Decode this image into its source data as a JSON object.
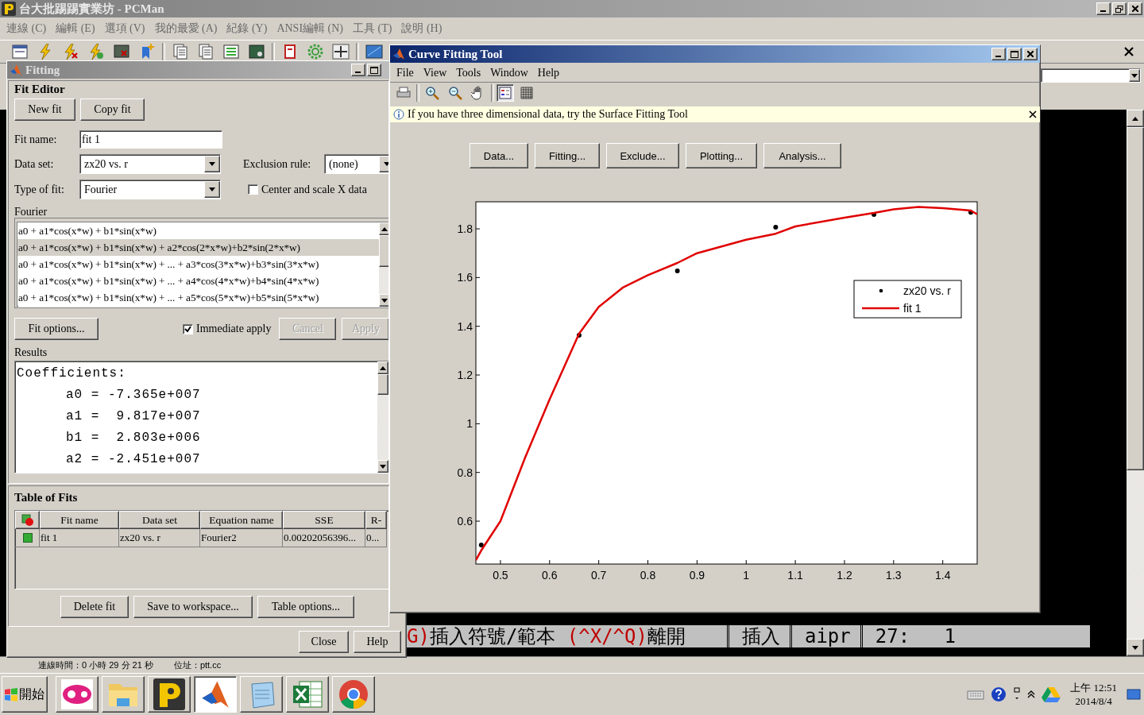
{
  "pcman": {
    "title": "台大批踢踢實業坊 - PCMan",
    "menu": [
      "連線 (C)",
      "編輯 (E)",
      "選項 (V)",
      "我的最愛 (A)",
      "紀錄 (Y)",
      "ANSI編輯 (N)",
      "工具 (T)",
      "說明 (H)"
    ],
    "terminal_status": [
      {
        "text": "G)",
        "color": "#c00000"
      },
      {
        "text": "插入符號/範本 ",
        "color": "#000000"
      },
      {
        "text": "(^X/^Q)",
        "color": "#c00000"
      },
      {
        "text": "離開",
        "color": "#000000"
      }
    ],
    "terminal_fields": [
      "插入",
      "aipr",
      "27:   1"
    ],
    "status_bar": {
      "connection_time": "連線時間：0 小時 29 分 21 秒",
      "address": "位址：ptt.cc"
    }
  },
  "fitting_window": {
    "title": "Fitting",
    "heading": "Fit Editor",
    "top_buttons": [
      "New fit",
      "Copy fit"
    ],
    "fit_name": {
      "label": "Fit name:",
      "value": "fit 1"
    },
    "data_set": {
      "label": "Data set:",
      "value": "zx20 vs. r"
    },
    "exclusion_rule": {
      "label": "Exclusion rule:",
      "value": "(none)"
    },
    "type_of_fit": {
      "label": "Type of fit:",
      "value": "Fourier"
    },
    "center_scale": {
      "label": "Center and scale X data",
      "checked": false
    },
    "equation_group": {
      "label": "Fourier",
      "items": [
        {
          "text": "a0 + a1*cos(x*w) + b1*sin(x*w)",
          "selected": false
        },
        {
          "text": "a0 + a1*cos(x*w) + b1*sin(x*w) + a2*cos(2*x*w)+b2*sin(2*x*w)",
          "selected": true
        },
        {
          "text": "a0 + a1*cos(x*w) + b1*sin(x*w) + ... + a3*cos(3*x*w)+b3*sin(3*x*w)",
          "selected": false
        },
        {
          "text": "a0 + a1*cos(x*w) + b1*sin(x*w) + ... + a4*cos(4*x*w)+b4*sin(4*x*w)",
          "selected": false
        },
        {
          "text": "a0 + a1*cos(x*w) + b1*sin(x*w) + ... + a5*cos(5*x*w)+b5*sin(5*x*w)",
          "selected": false
        }
      ]
    },
    "fit_options_button": "Fit options...",
    "immediate_apply": {
      "label": "Immediate apply",
      "checked": true
    },
    "action_buttons": [
      {
        "label": "Cancel",
        "disabled": true
      },
      {
        "label": "Apply",
        "disabled": true
      }
    ],
    "results": {
      "label": "Results",
      "lines": [
        {
          "kind": "heading",
          "text": "Coefficients:"
        },
        {
          "kind": "coefficient",
          "text": "a0 = -7.365e+007"
        },
        {
          "kind": "coefficient",
          "text": "a1 =  9.817e+007"
        },
        {
          "kind": "coefficient",
          "text": "b1 =  2.803e+006"
        },
        {
          "kind": "coefficient",
          "text": "a2 = -2.451e+007"
        }
      ]
    },
    "table": {
      "heading": "Table of Fits",
      "columns": [
        "Fit name",
        "Data set",
        "Equation name",
        "SSE",
        "R-"
      ],
      "rows": [
        {
          "cells": [
            "fit 1",
            "zx20 vs. r",
            "Fourier2",
            "0.00202056396...",
            "0..."
          ]
        }
      ]
    },
    "table_buttons": [
      "Delete fit",
      "Save to workspace...",
      "Table options..."
    ],
    "bottom_buttons": [
      "Close",
      "Help"
    ]
  },
  "curve_fitting_tool": {
    "title": "Curve Fitting Tool",
    "menu": [
      "File",
      "View",
      "Tools",
      "Window",
      "Help"
    ],
    "info": "If you have three dimensional data, try the Surface Fitting Tool",
    "buttons": [
      "Data...",
      "Fitting...",
      "Exclude...",
      "Plotting...",
      "Analysis..."
    ],
    "chart_data": {
      "type": "scatter",
      "x": [
        0.45,
        0.461,
        0.5,
        0.55,
        0.6,
        0.66,
        0.7,
        0.75,
        0.8,
        0.86,
        0.9,
        1.0,
        1.06,
        1.1,
        1.2,
        1.26,
        1.3,
        1.35,
        1.4,
        1.457,
        1.47
      ],
      "xlim": [
        0.45,
        1.47
      ],
      "ylim": [
        0.424,
        1.911
      ],
      "xticks": [
        0.5,
        0.6,
        0.7,
        0.8,
        0.9,
        1,
        1.1,
        1.2,
        1.3,
        1.4
      ],
      "yticks": [
        0.6,
        0.8,
        1,
        1.2,
        1.4,
        1.6,
        1.8
      ],
      "series": [
        {
          "name": "zx20 vs. r",
          "color": "#000000",
          "values": [
            null,
            0.502,
            null,
            null,
            null,
            1.363,
            null,
            null,
            null,
            1.627,
            null,
            null,
            1.807,
            null,
            null,
            1.859,
            null,
            null,
            null,
            1.868,
            null
          ]
        },
        {
          "name": "fit 1",
          "color": "#e00000",
          "type": "line",
          "values": [
            0.44,
            0.48,
            0.6,
            0.86,
            1.1,
            1.37,
            1.48,
            1.56,
            1.61,
            1.66,
            1.7,
            1.755,
            1.78,
            1.81,
            1.846,
            1.865,
            1.88,
            1.89,
            1.885,
            1.875,
            1.86
          ]
        }
      ]
    }
  },
  "taskbar": {
    "start": "開始",
    "clock_time": "上午 12:51",
    "clock_date": "2014/8/4"
  }
}
